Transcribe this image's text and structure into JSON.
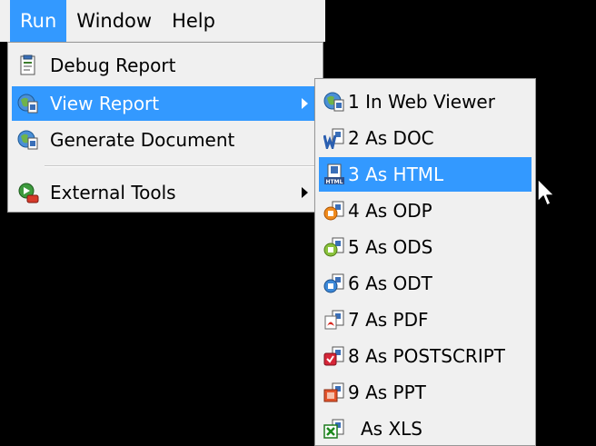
{
  "menubar": {
    "items": [
      {
        "label": "Run",
        "active": true
      },
      {
        "label": "Window",
        "active": false
      },
      {
        "label": "Help",
        "active": false
      }
    ]
  },
  "run_menu": {
    "items": [
      {
        "label": "Debug Report",
        "icon": "report-page-icon",
        "submenu": false
      },
      {
        "label": "View Report",
        "icon": "globe-report-icon",
        "submenu": true,
        "highlighted": true
      },
      {
        "label": "Generate Document",
        "icon": "globe-report-icon",
        "submenu": false
      },
      {
        "label": "External Tools",
        "icon": "external-tools-icon",
        "submenu": true
      }
    ]
  },
  "view_report_submenu": {
    "items": [
      {
        "label": "1 In Web Viewer",
        "icon": "globe-report-icon"
      },
      {
        "label": "2 As DOC",
        "icon": "word-doc-icon"
      },
      {
        "label": "3 As HTML",
        "icon": "html-doc-icon",
        "highlighted": true
      },
      {
        "label": "4 As ODP",
        "icon": "odp-doc-icon"
      },
      {
        "label": "5 As ODS",
        "icon": "ods-doc-icon"
      },
      {
        "label": "6 As ODT",
        "icon": "odt-doc-icon"
      },
      {
        "label": "7 As PDF",
        "icon": "pdf-doc-icon"
      },
      {
        "label": "8 As POSTSCRIPT",
        "icon": "postscript-doc-icon"
      },
      {
        "label": "9 As PPT",
        "icon": "ppt-doc-icon"
      },
      {
        "label": "As XLS",
        "icon": "xls-doc-icon"
      }
    ]
  },
  "colors": {
    "menu_bg": "#f0f0f0",
    "highlight": "#3399ff",
    "backdrop": "#000000"
  }
}
